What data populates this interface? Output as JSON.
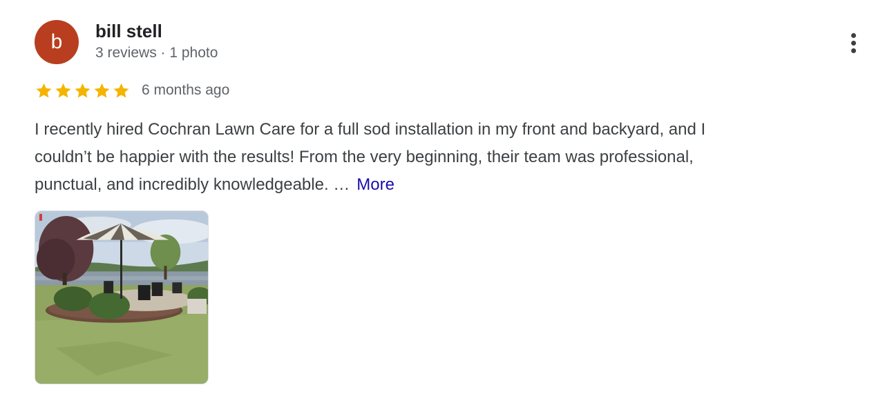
{
  "reviewer": {
    "avatar_letter": "b",
    "avatar_color": "#b83e1f",
    "name": "bill stell",
    "meta": "3 reviews · 1 photo"
  },
  "rating": {
    "stars": 5,
    "max_stars": 5,
    "star_color": "#f4b400",
    "date": "6 months ago"
  },
  "review": {
    "text_lines": [
      "I recently hired Cochran Lawn Care for a full sod installation in my front and backyard, and I",
      "couldn’t be happier with the results! From the very beginning, their team was professional,",
      "punctual, and incredibly knowledgeable. …"
    ],
    "more_label": "More",
    "link_color": "#1a0dab"
  },
  "photos": [
    {
      "icon": "patio-umbrella-lawn-photo"
    }
  ],
  "menu": {
    "icon": "more-vert-icon"
  }
}
